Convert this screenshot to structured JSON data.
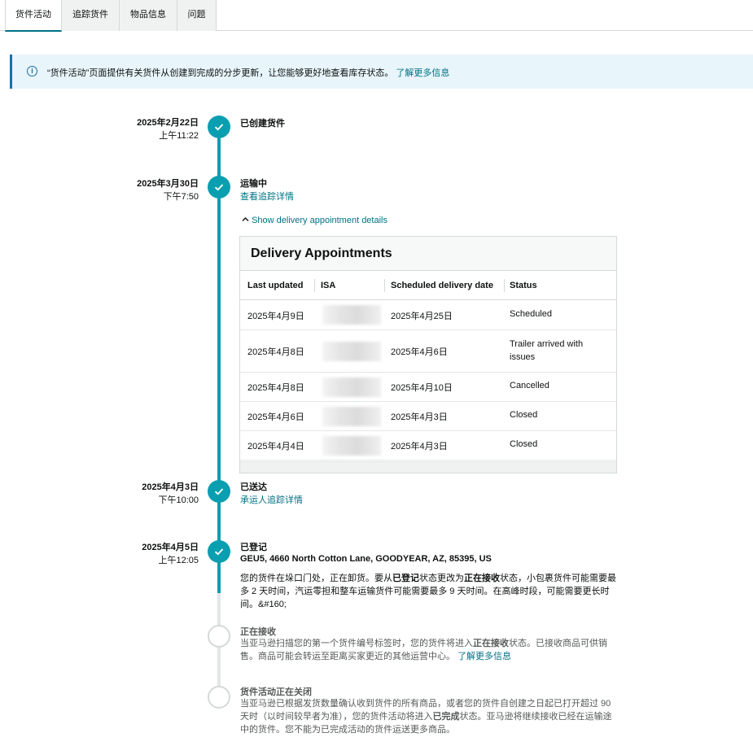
{
  "tabs": [
    {
      "label": "货件活动",
      "active": true
    },
    {
      "label": "追踪货件",
      "active": false
    },
    {
      "label": "物品信息",
      "active": false
    },
    {
      "label": "问题",
      "active": false
    }
  ],
  "banner": {
    "icon": "info-icon",
    "text": "“货件活动”页面提供有关货件从创建到完成的分步更新，让您能够更好地查看库存状态。",
    "link": "了解更多信息"
  },
  "timeline": {
    "created": {
      "date": "2025年2月22日",
      "time": "上午11:22",
      "title": "已创建货件"
    },
    "in_transit": {
      "date": "2025年3月30日",
      "time": "下午7:50",
      "title": "运输中",
      "link": "查看追踪详情",
      "toggle": "Show delivery appointment details"
    },
    "delivered": {
      "date": "2025年4月3日",
      "time": "下午10:00",
      "title": "已送达",
      "link": "承运人追踪详情"
    },
    "checked_in": {
      "date": "2025年4月5日",
      "time": "上午12:05",
      "title": "已登记",
      "address": "GEU5, 4660 North Cotton Lane, GOODYEAR, AZ, 85395, US",
      "para_1": "您的货件在垛口门处，正在卸货。要从",
      "para_bold_1": "已登记",
      "para_2": "状态更改为",
      "para_bold_2": "正在接收",
      "para_3": "状态，小包裹货件可能需要最多 2 天时间，汽运零担和整车运输货件可能需要最多 9 天时间。在高峰时段，可能需要更长时间。&#160;"
    },
    "receiving": {
      "title": "正在接收",
      "para_1": "当亚马逊扫描您的第一个货件编号标签时，您的货件将进入",
      "para_bold": "正在接收",
      "para_2": "状态。已接收商品可供销售。商品可能会转运至距离买家更近的其他运营中心。",
      "link": "了解更多信息"
    },
    "closing": {
      "title": "货件活动正在关闭",
      "para_1": "当亚马逊已根据发货数量确认收到货件的所有商品，或者您的货件自创建之日起已打开超过 90 天时（以时间较早者为准），您的货件活动将进入",
      "para_bold": "已完成",
      "para_2": "状态。亚马逊将继续接收已经在运输途中的货件。您不能为已完成活动的货件运送更多商品。"
    }
  },
  "appointments": {
    "title": "Delivery Appointments",
    "headers": [
      "Last updated",
      "ISA",
      "Scheduled delivery date",
      "Status"
    ],
    "rows": [
      {
        "updated": "2025年4月9日",
        "date": "2025年4月25日",
        "status": "Scheduled"
      },
      {
        "updated": "2025年4月8日",
        "date": "2025年4月6日",
        "status": "Trailer arrived with issues"
      },
      {
        "updated": "2025年4月8日",
        "date": "2025年4月10日",
        "status": "Cancelled"
      },
      {
        "updated": "2025年4月6日",
        "date": "2025年4月3日",
        "status": "Closed"
      },
      {
        "updated": "2025年4月4日",
        "date": "2025年4月3日",
        "status": "Closed"
      }
    ]
  },
  "colors": {
    "accent": "#0a9fb0",
    "link": "#007185",
    "banner_bg": "#e8f5fb",
    "banner_border": "#1e6fa8"
  }
}
